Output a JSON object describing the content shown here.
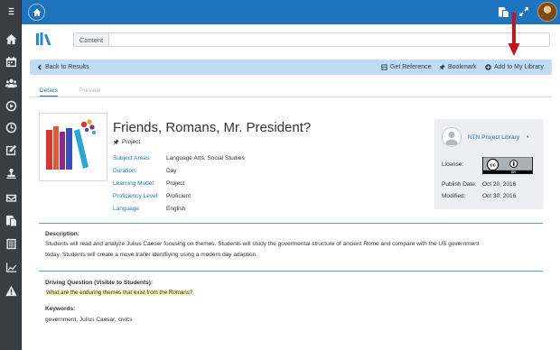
{
  "sidebar": {
    "items": [
      {
        "icon": "menu-icon"
      },
      {
        "icon": "home-icon"
      },
      {
        "icon": "calendar-icon"
      },
      {
        "icon": "users-icon"
      },
      {
        "icon": "play-circle-icon"
      },
      {
        "icon": "clock-icon"
      },
      {
        "icon": "edit-icon"
      },
      {
        "icon": "stamp-icon"
      },
      {
        "icon": "mail-icon"
      },
      {
        "icon": "copy-icon"
      },
      {
        "icon": "list-icon"
      },
      {
        "icon": "chart-icon"
      },
      {
        "icon": "warning-icon"
      }
    ]
  },
  "topbar": {
    "icons": [
      "home-icon",
      "copy-icon",
      "expand-icon",
      "user-avatar"
    ],
    "color": "#1d73bd"
  },
  "search": {
    "label": "Content",
    "value": ""
  },
  "actions": {
    "back": "Back to Results",
    "reference": "Get Reference",
    "bookmark": "Bookmark",
    "add_library": "Add to My Library"
  },
  "tabs": {
    "details": "Details",
    "preview": "Preview"
  },
  "resource": {
    "title": "Friends, Romans, Mr. President?",
    "type": "Project",
    "meta": [
      {
        "label": "Subject Areas:",
        "value": "Language Arts, Social Studies"
      },
      {
        "label": "Duration:",
        "value": "Day"
      },
      {
        "label": "Learning Model:",
        "value": "Project"
      },
      {
        "label": "Proficiency Level:",
        "value": "Proficient"
      },
      {
        "label": "Language:",
        "value": "English"
      }
    ]
  },
  "library": {
    "name": "NTN Project Library",
    "caret": "▾",
    "license_label": "License:",
    "license_badge": {
      "cc": "cc",
      "by": "BY"
    },
    "publish_label": "Publish Date:",
    "publish_date": "Oct 20, 2016",
    "modified_label": "Modified:",
    "modified_date": "Oct 30, 2016"
  },
  "description": {
    "heading": "Description:",
    "line1": "Students will read and analyze Julius Caeser focusing on themes. Students will study the govermental structure of ancient Rome and compare with the US government",
    "line2": "today. Students will create a move trailer identfiying using a modern day adaption."
  },
  "driving_question": {
    "heading": "Driving Question (Visible to Students):",
    "text": "What are the enduring themes that exist from the Romans?"
  },
  "keywords": {
    "heading": "Keywords:",
    "text": "government, Julius Caesar, civics"
  },
  "colors": {
    "accent": "#1d73bd",
    "action_bar": "#bfdcf4",
    "sidebar": "#3a3d42",
    "highlight": "#fbf6bf",
    "arrow": "#c0161e"
  }
}
